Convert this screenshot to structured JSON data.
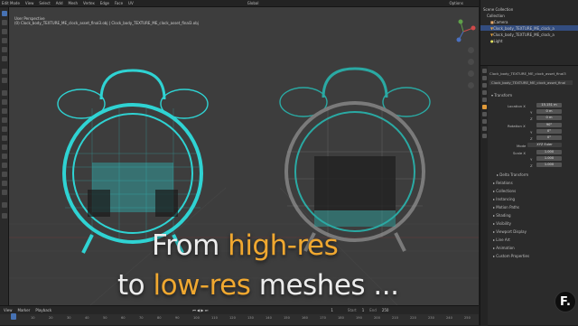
{
  "topbar": {
    "mode": "Edit Mode",
    "menus": [
      "View",
      "Select",
      "Add",
      "Mesh",
      "Vertex",
      "Edge",
      "Face",
      "UV"
    ],
    "orientation": "Global",
    "options": "Options"
  },
  "viewport": {
    "view_name": "User Perspective",
    "object_info": "(0) Clock_body_TEXTURE_ME_clock_asset_final3.obj | Clock_body_TEXTURE_ME_clock_asset_final3.obj",
    "caption_line1_a": "From ",
    "caption_line1_b": "high-res",
    "caption_line2_a": "to ",
    "caption_line2_b": "low-res",
    "caption_line2_c": " meshes ...",
    "left_mesh_color": "#2fd3d3",
    "right_mesh_color": "#2aa9a3",
    "accent_color": "#f0a830"
  },
  "timeline": {
    "menus": [
      "View",
      "Marker",
      "Playback"
    ],
    "ticks": [
      "0",
      "10",
      "20",
      "30",
      "40",
      "50",
      "60",
      "70",
      "80",
      "90",
      "100",
      "110",
      "120",
      "130",
      "140",
      "150",
      "160",
      "170",
      "180",
      "190",
      "200",
      "210",
      "220",
      "230",
      "240",
      "250"
    ],
    "current_frame": "1",
    "start_label": "Start",
    "start": "1",
    "end_label": "End",
    "end": "250"
  },
  "outliner": {
    "rows": [
      {
        "label": "Scene Collection",
        "selected": false
      },
      {
        "label": "Collection",
        "selected": false
      },
      {
        "label": "Camera",
        "selected": false
      },
      {
        "label": "Clock_body_TEXTURE_ME_clock_a",
        "selected": true
      },
      {
        "label": "Clock_body_TEXTURE_ME_clock_a",
        "selected": false
      },
      {
        "label": "Light",
        "selected": false
      }
    ]
  },
  "properties": {
    "object_name": "Clock_body_TEXTURE_ME_clock_asset_final3",
    "data_name": "Clock_body_TEXTURE_ME_clock_asset_final",
    "transform_header": "Transform",
    "location_label": "Location X",
    "location": [
      "15.151 m",
      "0 m",
      "0 m"
    ],
    "rotation_label": "Rotation X",
    "rotation": [
      "90°",
      "0°",
      "0°"
    ],
    "mode_label": "Mode",
    "mode_value": "XYZ Euler",
    "scale_label": "Scale X",
    "scale": [
      "1.000",
      "1.000",
      "1.000"
    ],
    "axis_y": "Y",
    "axis_z": "Z",
    "sections": [
      "Delta Transform",
      "Relations",
      "Collections",
      "Instancing",
      "Motion Paths",
      "Shading",
      "Visibility",
      "Viewport Display",
      "Line Art",
      "Animation",
      "Custom Properties"
    ]
  },
  "logo": {
    "text": "F."
  }
}
